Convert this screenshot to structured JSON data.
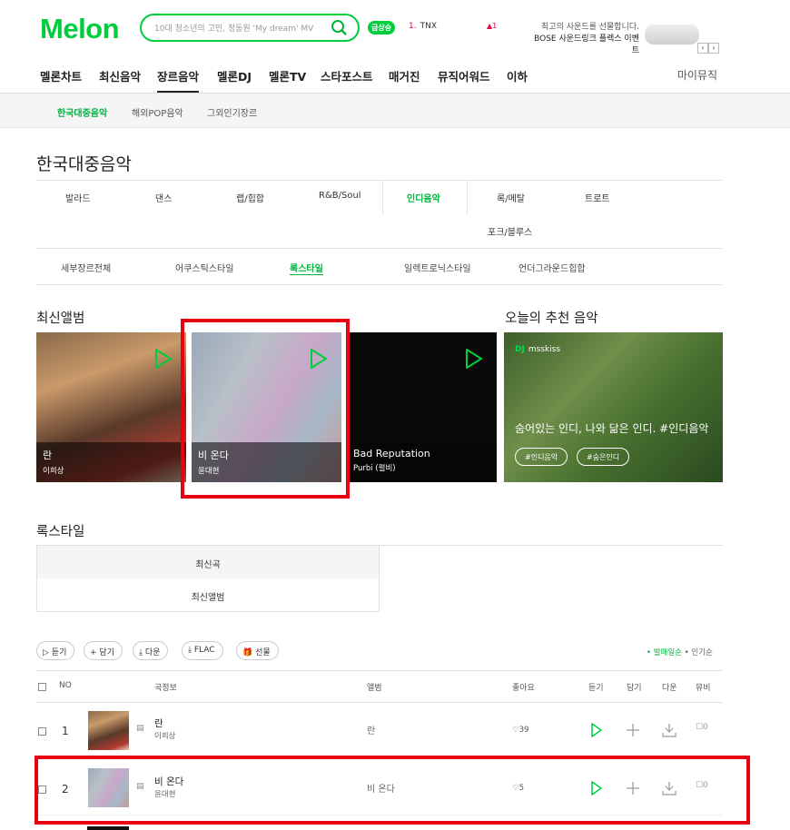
{
  "header": {
    "logo": "Melon",
    "search_placeholder": "10대 청소년의 고민, 정동원 'My dream' MV",
    "live_badge": "급상승",
    "rank_num": "1.",
    "rank_text": "TNX",
    "rank_change": "1",
    "ad_line1": "최고의 사운드를 선물합니다.",
    "ad_line2": "BOSE 사운드링크 플렉스 이벤트"
  },
  "gnb": {
    "items": [
      "멜론차트",
      "최신음악",
      "장르음악",
      "멜론DJ",
      "멜론TV",
      "스타포스트",
      "매거진",
      "뮤직어워드",
      "이하"
    ],
    "active": "장르음악",
    "my": "마이뮤직"
  },
  "subnav": [
    "한국대중음악",
    "해외POP음악",
    "그외인기장르"
  ],
  "page_title": "한국대중음악",
  "genres": {
    "row1": [
      "발라드",
      "댄스",
      "랩/힙합",
      "R&B/Soul",
      "인디음악",
      "록/메탈",
      "트로트"
    ],
    "row2": [
      "포크/블루스"
    ],
    "active": "인디음악"
  },
  "styles": {
    "items": [
      "세부장르전체",
      "어쿠스틱스타일",
      "록스타일",
      "일렉트로닉스타일",
      "언더그라운드힙합"
    ],
    "active": "록스타일"
  },
  "latest_title": "최신앨범",
  "albums": [
    {
      "title": "란",
      "artist": "이희상"
    },
    {
      "title": "비 온다",
      "artist": "윤대현"
    },
    {
      "title": "Bad Reputation",
      "artist": "Purbi (펄비)"
    }
  ],
  "recommend": {
    "title": "오늘의 추천 음악",
    "dj": "DJ",
    "user": "msskiss",
    "desc": "숨어있는 인디, 나와 닮은 인디. #인디음악",
    "tags": [
      "#인디음악",
      "#숨은인디"
    ]
  },
  "section2_title": "록스타일",
  "tabs": [
    "최신곡",
    "최신앨범"
  ],
  "buttons": [
    "듣기",
    "담기",
    "다운",
    "FLAC",
    "선물"
  ],
  "sort": {
    "new": "발매일순",
    "pop": "인기순"
  },
  "table": {
    "headers": [
      "NO",
      "곡정보",
      "앨범",
      "좋아요",
      "듣기",
      "담기",
      "다운",
      "뮤비"
    ],
    "rows": [
      {
        "no": "1",
        "title": "란",
        "artist": "이희상",
        "album": "란",
        "likes": "39",
        "mv": "0"
      },
      {
        "no": "2",
        "title": "비 온다",
        "artist": "윤대현",
        "album": "비 온다",
        "likes": "5",
        "mv": "0"
      }
    ]
  },
  "colors": {
    "brand": "#00cd3c",
    "highlight": "#e60012"
  }
}
